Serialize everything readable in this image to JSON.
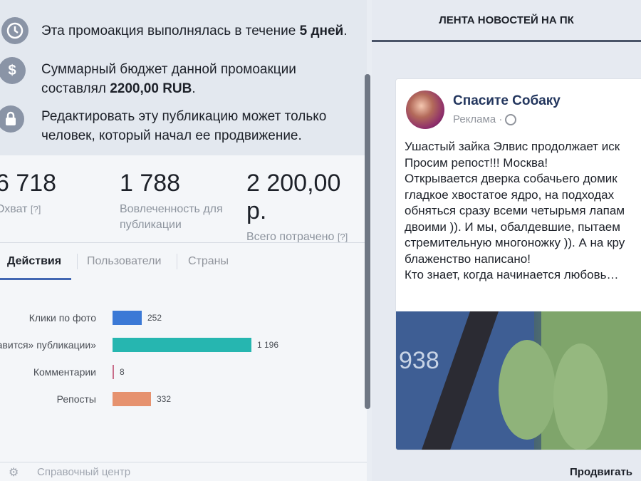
{
  "info": {
    "duration_prefix": "Эта промоакция выполнялась в течение ",
    "duration_value": "5 дней",
    "duration_suffix": ".",
    "budget_line1": "Суммарный бюджет данной промоакции",
    "budget_prefix": "составлял ",
    "budget_value": "2200,00 RUB",
    "budget_suffix": ".",
    "edit_line1": "Редактировать эту публикацию может только",
    "edit_line2": "человек, который начал ее продвижение."
  },
  "stats": [
    {
      "value": "6 718",
      "label": "Охват",
      "hint": "[?]"
    },
    {
      "value": "1 788",
      "label_line1": "Вовлеченность для",
      "label_line2": "публикации"
    },
    {
      "value": "2 200,00 р.",
      "label": "Всего потрачено",
      "hint": "[?]"
    }
  ],
  "tabs": [
    "Действия",
    "Пользователи",
    "Страны"
  ],
  "actions_chart": {
    "rows": [
      {
        "label": "Клики по фото",
        "value": 252,
        "display": "252",
        "color": "#3b79d6"
      },
      {
        "label": "«Нравится» публикации",
        "value": 1196,
        "display": "1 196",
        "color": "#26b6b0"
      },
      {
        "label": "Комментарии",
        "value": 8,
        "display": "8",
        "color": "#c86d8a"
      },
      {
        "label": "Репосты",
        "value": 332,
        "display": "332",
        "color": "#e6926f"
      }
    ],
    "max": 1196
  },
  "footer": {
    "help": "Справочный центр",
    "promote": "Продвигать е"
  },
  "feed": {
    "title": "ЛЕНТА НОВОСТЕЙ НА ПК",
    "page_name": "Спасите Собаку",
    "sponsored": "Реклама ·",
    "post_lines": [
      "Ушастый зайка Элвис продолжает иск",
      "Просим репост!!! Москва!",
      "Открывается дверка собачьего домик",
      "гладкое хвостатое ядро, на подходах",
      "обняться сразу всеми четырьмя лапам",
      "двоими )). И мы, обалдевшие, пытаем",
      "стремительную многоножку )). А на кру",
      "блаженство написано!",
      "Кто знает, когда начинается любовь…"
    ]
  },
  "icons": {
    "clock": "clock-icon",
    "dollar": "dollar-icon",
    "lock": "lock-icon",
    "gear": "gear-icon",
    "globe": "globe-icon"
  }
}
